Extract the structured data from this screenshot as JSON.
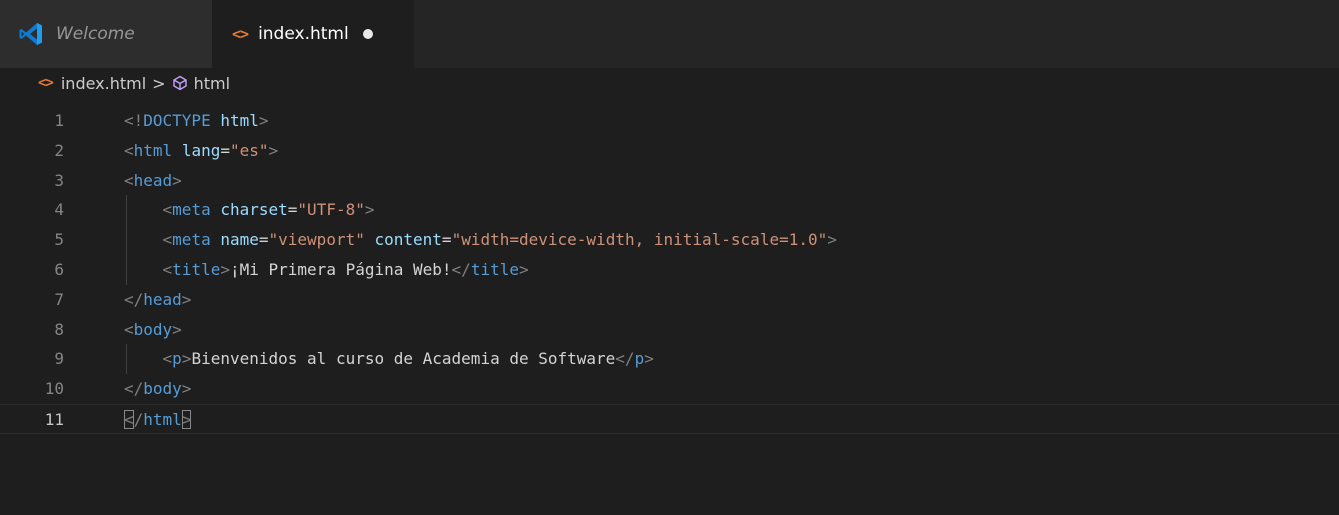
{
  "tabs": [
    {
      "label": "Welcome",
      "active": false,
      "icon": "vscode-logo-icon"
    },
    {
      "label": "index.html",
      "active": true,
      "icon": "html-file-icon",
      "dirty": true
    }
  ],
  "breadcrumb": {
    "file": "index.html",
    "separator": ">",
    "symbol": "html"
  },
  "colors": {
    "editor_bg": "#1e1e1e",
    "tabbar_bg": "#252526",
    "tag": "#569cd6",
    "attr": "#9cdcfe",
    "string": "#ce9178",
    "html_icon": "#e37933"
  },
  "code_lines": [
    {
      "n": "1",
      "tokens": [
        [
          "b",
          "<!"
        ],
        [
          "d",
          "DOCTYPE"
        ],
        [
          "x",
          " "
        ],
        [
          "k",
          "html"
        ],
        [
          "b",
          ">"
        ]
      ]
    },
    {
      "n": "2",
      "tokens": [
        [
          "b",
          "<"
        ],
        [
          "g",
          "html"
        ],
        [
          "x",
          " "
        ],
        [
          "a",
          "lang"
        ],
        [
          "x",
          "="
        ],
        [
          "s",
          "\"es\""
        ],
        [
          "b",
          ">"
        ]
      ]
    },
    {
      "n": "3",
      "tokens": [
        [
          "b",
          "<"
        ],
        [
          "g",
          "head"
        ],
        [
          "b",
          ">"
        ]
      ]
    },
    {
      "n": "4",
      "tokens": [
        [
          "x",
          "    "
        ],
        [
          "b",
          "<"
        ],
        [
          "g",
          "meta"
        ],
        [
          "x",
          " "
        ],
        [
          "a",
          "charset"
        ],
        [
          "x",
          "="
        ],
        [
          "s",
          "\"UTF-8\""
        ],
        [
          "b",
          ">"
        ]
      ]
    },
    {
      "n": "5",
      "tokens": [
        [
          "x",
          "    "
        ],
        [
          "b",
          "<"
        ],
        [
          "g",
          "meta"
        ],
        [
          "x",
          " "
        ],
        [
          "a",
          "name"
        ],
        [
          "x",
          "="
        ],
        [
          "s",
          "\"viewport\""
        ],
        [
          "x",
          " "
        ],
        [
          "a",
          "content"
        ],
        [
          "x",
          "="
        ],
        [
          "s",
          "\"width=device-width, initial-scale=1.0\""
        ],
        [
          "b",
          ">"
        ]
      ]
    },
    {
      "n": "6",
      "tokens": [
        [
          "x",
          "    "
        ],
        [
          "b",
          "<"
        ],
        [
          "g",
          "title"
        ],
        [
          "b",
          ">"
        ],
        [
          "x",
          "¡Mi Primera Página Web!"
        ],
        [
          "b",
          "</"
        ],
        [
          "g",
          "title"
        ],
        [
          "b",
          ">"
        ]
      ]
    },
    {
      "n": "7",
      "tokens": [
        [
          "b",
          "</"
        ],
        [
          "g",
          "head"
        ],
        [
          "b",
          ">"
        ]
      ]
    },
    {
      "n": "8",
      "tokens": [
        [
          "b",
          "<"
        ],
        [
          "g",
          "body"
        ],
        [
          "b",
          ">"
        ]
      ]
    },
    {
      "n": "9",
      "tokens": [
        [
          "x",
          "    "
        ],
        [
          "b",
          "<"
        ],
        [
          "g",
          "p"
        ],
        [
          "b",
          ">"
        ],
        [
          "x",
          "Bienvenidos al curso de Academia de Software"
        ],
        [
          "b",
          "</"
        ],
        [
          "g",
          "p"
        ],
        [
          "b",
          ">"
        ]
      ]
    },
    {
      "n": "10",
      "tokens": [
        [
          "b",
          "</"
        ],
        [
          "g",
          "body"
        ],
        [
          "b",
          ">"
        ]
      ]
    },
    {
      "n": "11",
      "tokens": [
        [
          "m",
          "<"
        ],
        [
          "b",
          "/"
        ],
        [
          "g",
          "html"
        ],
        [
          "m",
          ">"
        ]
      ]
    }
  ]
}
